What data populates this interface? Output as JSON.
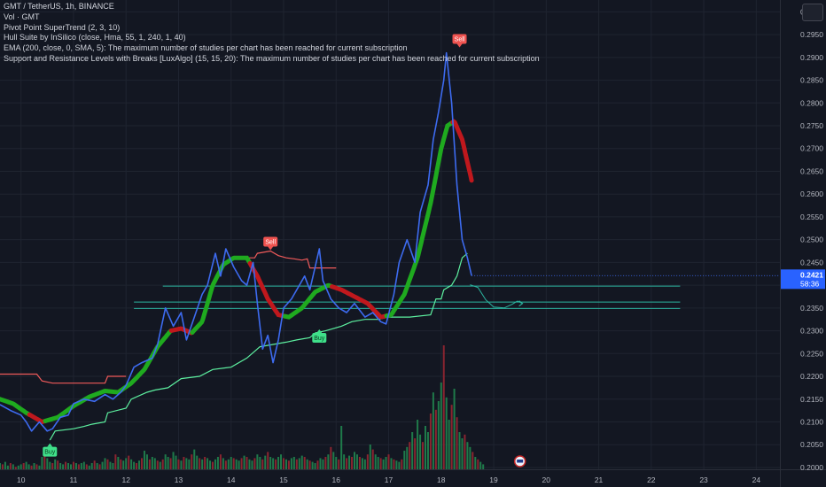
{
  "legend": {
    "symbol_line": "GMT / TetherUS, 1h, BINANCE",
    "volume_line": "Vol · GMT",
    "line3": "Pivot Point SuperTrend (2, 3, 10)",
    "line4": "Hull Suite by InSilico (close, Hma, 55, 1, 240, 1, 40)",
    "line5": "EMA (200, close, 0, SMA, 5): The maximum number of studies per chart has been reached for current subscription",
    "line6": " Support and Resistance Levels with Breaks [LuxAlgo] (15, 15, 20): The maximum number of studies per chart has been reached for current subscription"
  },
  "price_badge": {
    "price": "0.2421",
    "countdown": "58:36",
    "color": "#2962ff"
  },
  "chart_data": {
    "type": "line",
    "x_axis_labels": [
      "10",
      "11",
      "12",
      "13",
      "14",
      "15",
      "16",
      "17",
      "18",
      "19",
      "20",
      "21",
      "22",
      "23",
      "24"
    ],
    "x_axis_days": [
      10,
      11,
      12,
      13,
      14,
      15,
      16,
      17,
      18,
      19,
      20,
      21,
      22,
      23,
      24
    ],
    "y_axis_labels": [
      "0.3000",
      "0.2950",
      "0.2900",
      "0.2850",
      "0.2800",
      "0.2750",
      "0.2700",
      "0.2650",
      "0.2600",
      "0.2550",
      "0.2500",
      "0.2450",
      "0.2400",
      "0.2350",
      "0.2300",
      "0.2250",
      "0.2200",
      "0.2150",
      "0.2100",
      "0.2050",
      "0.2000"
    ],
    "ylim": [
      0.1996,
      0.3026
    ],
    "xlim": [
      9.6,
      24.45
    ],
    "colors": {
      "price": "#3d6bf0",
      "hull_up": "#1faa1f",
      "hull_down": "#c0181d",
      "supertrend_bear": "#f05a5a",
      "supertrend_bull": "#5df0a0",
      "support_line": "#2bb5a0",
      "vol_up": "#1f7a4a",
      "vol_down": "#8a2530"
    },
    "series": [
      {
        "name": "GMT / TetherUS",
        "points": [
          [
            9.6,
            0.2138
          ],
          [
            9.8,
            0.2125
          ],
          [
            10.0,
            0.2115
          ],
          [
            10.1,
            0.21
          ],
          [
            10.2,
            0.208
          ],
          [
            10.35,
            0.21
          ],
          [
            10.5,
            0.208
          ],
          [
            10.6,
            0.2085
          ],
          [
            10.75,
            0.211
          ],
          [
            10.9,
            0.2115
          ],
          [
            11.0,
            0.214
          ],
          [
            11.2,
            0.215
          ],
          [
            11.4,
            0.2145
          ],
          [
            11.6,
            0.216
          ],
          [
            11.75,
            0.215
          ],
          [
            11.9,
            0.2165
          ],
          [
            12.0,
            0.218
          ],
          [
            12.15,
            0.222
          ],
          [
            12.3,
            0.223
          ],
          [
            12.5,
            0.224
          ],
          [
            12.6,
            0.227
          ],
          [
            12.75,
            0.235
          ],
          [
            12.9,
            0.231
          ],
          [
            13.05,
            0.234
          ],
          [
            13.15,
            0.228
          ],
          [
            13.3,
            0.233
          ],
          [
            13.45,
            0.238
          ],
          [
            13.55,
            0.24
          ],
          [
            13.7,
            0.247
          ],
          [
            13.8,
            0.242
          ],
          [
            13.9,
            0.248
          ],
          [
            14.05,
            0.244
          ],
          [
            14.2,
            0.241
          ],
          [
            14.3,
            0.24
          ],
          [
            14.42,
            0.245
          ],
          [
            14.5,
            0.236
          ],
          [
            14.6,
            0.226
          ],
          [
            14.7,
            0.229
          ],
          [
            14.8,
            0.223
          ],
          [
            14.9,
            0.228
          ],
          [
            15.0,
            0.235
          ],
          [
            15.15,
            0.237
          ],
          [
            15.3,
            0.24
          ],
          [
            15.4,
            0.242
          ],
          [
            15.5,
            0.239
          ],
          [
            15.6,
            0.244
          ],
          [
            15.68,
            0.248
          ],
          [
            15.75,
            0.241
          ],
          [
            15.9,
            0.237
          ],
          [
            16.05,
            0.235
          ],
          [
            16.2,
            0.234
          ],
          [
            16.35,
            0.236
          ],
          [
            16.55,
            0.233
          ],
          [
            16.7,
            0.234
          ],
          [
            16.85,
            0.232
          ],
          [
            16.95,
            0.2315
          ],
          [
            17.1,
            0.238
          ],
          [
            17.2,
            0.245
          ],
          [
            17.35,
            0.25
          ],
          [
            17.5,
            0.245
          ],
          [
            17.6,
            0.256
          ],
          [
            17.75,
            0.262
          ],
          [
            17.85,
            0.272
          ],
          [
            17.95,
            0.278
          ],
          [
            18.05,
            0.285
          ],
          [
            18.1,
            0.291
          ],
          [
            18.2,
            0.28
          ],
          [
            18.3,
            0.262
          ],
          [
            18.4,
            0.25
          ],
          [
            18.5,
            0.246
          ],
          [
            18.58,
            0.2421
          ]
        ]
      },
      {
        "name": "Hull MA",
        "points": [
          [
            9.6,
            0.215
          ],
          [
            9.85,
            0.214
          ],
          [
            10.1,
            0.212
          ],
          [
            10.4,
            0.21
          ],
          [
            10.7,
            0.211
          ],
          [
            11.0,
            0.2135
          ],
          [
            11.3,
            0.2155
          ],
          [
            11.6,
            0.2168
          ],
          [
            11.85,
            0.2165
          ],
          [
            12.1,
            0.2185
          ],
          [
            12.35,
            0.2215
          ],
          [
            12.6,
            0.2265
          ],
          [
            12.85,
            0.23
          ],
          [
            13.05,
            0.2305
          ],
          [
            13.25,
            0.2295
          ],
          [
            13.45,
            0.232
          ],
          [
            13.65,
            0.24
          ],
          [
            13.85,
            0.2445
          ],
          [
            14.05,
            0.246
          ],
          [
            14.3,
            0.246
          ],
          [
            14.5,
            0.242
          ],
          [
            14.7,
            0.237
          ],
          [
            14.9,
            0.2335
          ],
          [
            15.1,
            0.233
          ],
          [
            15.35,
            0.235
          ],
          [
            15.6,
            0.2385
          ],
          [
            15.85,
            0.24
          ],
          [
            16.1,
            0.239
          ],
          [
            16.35,
            0.2375
          ],
          [
            16.6,
            0.236
          ],
          [
            16.85,
            0.233
          ],
          [
            17.05,
            0.2335
          ],
          [
            17.3,
            0.238
          ],
          [
            17.55,
            0.246
          ],
          [
            17.8,
            0.258
          ],
          [
            18.0,
            0.27
          ],
          [
            18.12,
            0.275
          ],
          [
            18.25,
            0.276
          ],
          [
            18.4,
            0.272
          ],
          [
            18.5,
            0.267
          ],
          [
            18.58,
            0.263
          ]
        ],
        "down_ranges": [
          [
            10.15,
            10.45
          ],
          [
            12.85,
            13.25
          ],
          [
            14.35,
            15.0
          ],
          [
            15.9,
            16.95
          ],
          [
            18.2,
            18.6
          ]
        ]
      },
      {
        "name": "Pivot Point SuperTrend (bear)",
        "points": [
          [
            9.6,
            0.2205
          ],
          [
            10.3,
            0.2205
          ],
          [
            10.4,
            0.219
          ],
          [
            10.6,
            0.2185
          ],
          [
            10.9,
            0.2185
          ],
          [
            11.6,
            0.2185
          ],
          [
            11.65,
            0.22
          ],
          [
            11.9,
            0.22
          ],
          [
            12.0,
            0.22
          ],
          [
            14.3,
            0.246
          ],
          [
            14.45,
            0.246
          ],
          [
            14.5,
            0.247
          ],
          [
            14.75,
            0.2475
          ],
          [
            14.9,
            0.2465
          ],
          [
            15.05,
            0.246
          ],
          [
            15.2,
            0.2458
          ],
          [
            15.35,
            0.2455
          ],
          [
            15.45,
            0.2458
          ],
          [
            15.5,
            0.2438
          ],
          [
            16.0,
            0.2438
          ]
        ]
      },
      {
        "name": "Pivot Point SuperTrend (bull)",
        "points": [
          [
            10.55,
            0.206
          ],
          [
            10.65,
            0.208
          ],
          [
            11.0,
            0.2085
          ],
          [
            11.2,
            0.209
          ],
          [
            11.35,
            0.2095
          ],
          [
            11.6,
            0.21
          ],
          [
            11.65,
            0.212
          ],
          [
            12.0,
            0.213
          ],
          [
            12.1,
            0.215
          ],
          [
            12.4,
            0.2165
          ],
          [
            12.55,
            0.217
          ],
          [
            12.8,
            0.2175
          ],
          [
            13.05,
            0.2195
          ],
          [
            13.4,
            0.22
          ],
          [
            13.65,
            0.2215
          ],
          [
            14.0,
            0.222
          ],
          [
            14.3,
            0.224
          ],
          [
            14.55,
            0.2265
          ],
          [
            14.8,
            0.227
          ],
          [
            15.05,
            0.2275
          ],
          [
            15.25,
            0.228
          ],
          [
            15.5,
            0.2285
          ],
          [
            15.6,
            0.2295
          ],
          [
            15.8,
            0.23
          ],
          [
            16.1,
            0.231
          ],
          [
            16.3,
            0.232
          ],
          [
            16.55,
            0.2325
          ],
          [
            16.8,
            0.2325
          ],
          [
            17.0,
            0.233
          ],
          [
            17.4,
            0.233
          ],
          [
            17.8,
            0.2335
          ],
          [
            17.9,
            0.237
          ],
          [
            18.0,
            0.237
          ],
          [
            18.05,
            0.239
          ],
          [
            18.2,
            0.24
          ],
          [
            18.3,
            0.242
          ],
          [
            18.4,
            0.246
          ],
          [
            18.5,
            0.247
          ]
        ]
      },
      {
        "name": "Projection",
        "points": [
          [
            18.55,
            0.2401
          ],
          [
            18.7,
            0.2395
          ],
          [
            18.85,
            0.2368
          ],
          [
            19.0,
            0.2352
          ],
          [
            19.2,
            0.235
          ],
          [
            19.35,
            0.2358
          ],
          [
            19.45,
            0.2365
          ],
          [
            19.55,
            0.236
          ]
        ]
      }
    ],
    "horizontal_levels": [
      {
        "value": 0.2398,
        "x_start": 12.7,
        "x_end": 22.55
      },
      {
        "value": 0.2363,
        "x_start": 12.15,
        "x_end": 22.55
      },
      {
        "value": 0.2349,
        "x_start": 12.15,
        "x_end": 22.55
      }
    ],
    "volume": {
      "x_start": 9.6,
      "x_step": 0.05,
      "values": [
        0.05,
        0.04,
        0.06,
        0.03,
        0.05,
        0.04,
        0.02,
        0.03,
        0.04,
        0.05,
        0.06,
        0.04,
        0.03,
        0.05,
        0.04,
        0.03,
        0.1,
        0.12,
        0.09,
        0.06,
        0.05,
        0.08,
        0.07,
        0.05,
        0.04,
        0.06,
        0.05,
        0.04,
        0.06,
        0.05,
        0.04,
        0.05,
        0.06,
        0.04,
        0.03,
        0.05,
        0.07,
        0.05,
        0.04,
        0.06,
        0.09,
        0.08,
        0.06,
        0.05,
        0.12,
        0.1,
        0.08,
        0.07,
        0.09,
        0.11,
        0.08,
        0.06,
        0.05,
        0.07,
        0.09,
        0.15,
        0.12,
        0.08,
        0.1,
        0.09,
        0.07,
        0.06,
        0.08,
        0.12,
        0.1,
        0.09,
        0.14,
        0.11,
        0.08,
        0.07,
        0.1,
        0.09,
        0.08,
        0.12,
        0.16,
        0.11,
        0.09,
        0.08,
        0.1,
        0.09,
        0.07,
        0.06,
        0.08,
        0.1,
        0.12,
        0.09,
        0.07,
        0.08,
        0.1,
        0.09,
        0.08,
        0.07,
        0.09,
        0.11,
        0.1,
        0.08,
        0.07,
        0.09,
        0.12,
        0.1,
        0.08,
        0.11,
        0.14,
        0.1,
        0.09,
        0.08,
        0.1,
        0.12,
        0.09,
        0.08,
        0.07,
        0.09,
        0.1,
        0.08,
        0.09,
        0.11,
        0.1,
        0.08,
        0.07,
        0.06,
        0.05,
        0.07,
        0.09,
        0.08,
        0.1,
        0.12,
        0.18,
        0.14,
        0.1,
        0.08,
        0.35,
        0.12,
        0.09,
        0.11,
        0.1,
        0.14,
        0.12,
        0.1,
        0.09,
        0.08,
        0.12,
        0.2,
        0.16,
        0.12,
        0.1,
        0.09,
        0.08,
        0.1,
        0.12,
        0.09,
        0.08,
        0.07,
        0.06,
        0.08,
        0.15,
        0.18,
        0.22,
        0.3,
        0.25,
        0.4,
        0.28,
        0.22,
        0.35,
        0.3,
        0.45,
        0.62,
        0.48,
        0.55,
        0.7,
        1.0,
        0.58,
        0.4,
        0.52,
        0.65,
        0.42,
        0.3,
        0.25,
        0.28,
        0.22,
        0.18,
        0.14,
        0.1,
        0.08,
        0.06,
        0.04
      ],
      "up_pattern": [
        1,
        0,
        1,
        1,
        0,
        1,
        0,
        1,
        1,
        0,
        1,
        1,
        0,
        1,
        0,
        1,
        1,
        0,
        1,
        1,
        0,
        1,
        0,
        1
      ]
    },
    "markers": [
      {
        "text": "Sell",
        "x": 14.75,
        "y": 0.2475,
        "type": "sell"
      },
      {
        "text": "Sell",
        "x": 18.35,
        "y": 0.292,
        "type": "sell"
      },
      {
        "text": "Buy",
        "x": 15.68,
        "y": 0.2305,
        "type": "buy"
      },
      {
        "text": "Buy",
        "x": 10.55,
        "y": 0.2055,
        "type": "buy"
      }
    ],
    "event_icon": {
      "x": 19.5
    }
  }
}
